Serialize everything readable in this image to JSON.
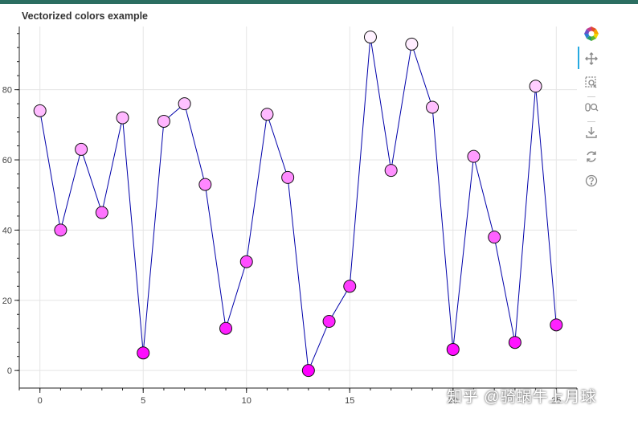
{
  "title": "Vectorized colors example",
  "watermark": "知乎 @骑蜗牛上月球",
  "toolbar": {
    "logo": "bokeh-logo-icon",
    "tools": [
      "pan-icon",
      "box-zoom-icon",
      "wheel-zoom-icon",
      "save-icon",
      "reset-icon",
      "help-icon"
    ]
  },
  "chart_data": {
    "type": "line",
    "title": "Vectorized colors example",
    "xlabel": "",
    "ylabel": "",
    "xlim": [
      -1,
      26
    ],
    "ylim": [
      -5,
      98
    ],
    "xticks": [
      0,
      5,
      10,
      15,
      20,
      25
    ],
    "yticks": [
      0,
      20,
      40,
      60,
      80
    ],
    "grid": true,
    "line_color": "#0000aa",
    "series": [
      {
        "x": [
          0,
          1,
          2,
          3,
          4,
          5,
          6,
          7,
          8,
          9,
          10,
          11,
          12,
          13,
          14,
          15,
          16,
          17,
          18,
          19,
          20,
          21,
          22,
          23,
          24,
          25
        ],
        "y": [
          74,
          40,
          63,
          45,
          72,
          5,
          71,
          76,
          53,
          12,
          31,
          73,
          55,
          0,
          14,
          24,
          95,
          57,
          93,
          75,
          6,
          61,
          38,
          8,
          81,
          13
        ]
      }
    ]
  }
}
